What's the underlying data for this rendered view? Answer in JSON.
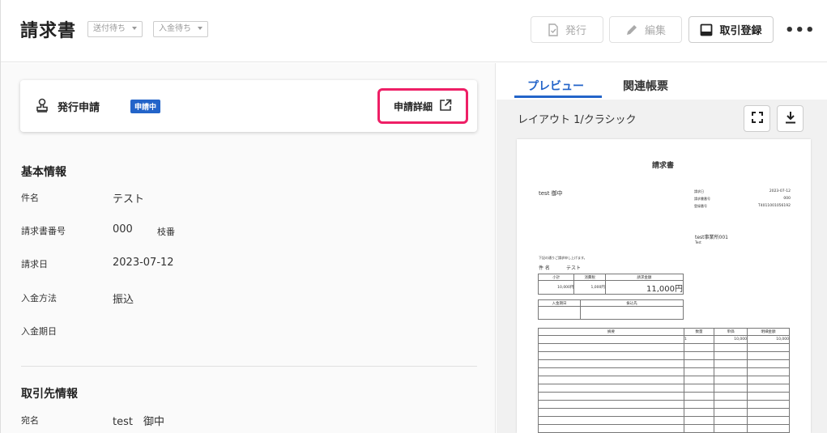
{
  "header": {
    "title": "請求書",
    "status_send": "送付待ち",
    "status_payment": "入金待ち",
    "issue_label": "発行",
    "edit_label": "編集",
    "register_label": "取引登録",
    "more_label": "•••"
  },
  "approval": {
    "label": "発行申請",
    "badge": "申請中",
    "detail_label": "申請詳細"
  },
  "basic": {
    "heading": "基本情報",
    "subject_label": "件名",
    "subject_value": "テスト",
    "number_label": "請求書番号",
    "number_value": "000",
    "branch_label": "枝番",
    "date_label": "請求日",
    "date_value": "2023-07-12",
    "method_label": "入金方法",
    "method_value": "振込",
    "due_label": "入金期日"
  },
  "partner": {
    "heading": "取引先情報",
    "name_label": "宛名",
    "name_value": "test　御中"
  },
  "preview": {
    "tab_preview": "プレビュー",
    "tab_related": "関連帳票",
    "layout_label": "レイアウト 1/クラシック",
    "doc": {
      "title": "請求書",
      "to": "test 御中",
      "meta_labels": [
        "請求日",
        "請求書番号",
        "登録番号"
      ],
      "meta_values": [
        "2023-07-12",
        "000",
        "T4011001056192"
      ],
      "company": "test事業所001",
      "company_sub": "Test",
      "note": "下記の通りご請求申し上げます。",
      "subject_label": "件 名",
      "subject_value": "テスト",
      "sum_headers": [
        "小計",
        "消費税",
        "請求金額"
      ],
      "sum_values": [
        "10,000円",
        "1,000円",
        "11,000円"
      ],
      "pay_headers": [
        "入金期日",
        "振込先"
      ],
      "item_headers": [
        "摘要",
        "数量",
        "単価",
        "明細金額"
      ],
      "item_row": [
        "",
        "1",
        "10,000",
        "10,000"
      ]
    }
  },
  "colors": {
    "accent": "#2364c9",
    "highlight": "#ee1f66"
  }
}
